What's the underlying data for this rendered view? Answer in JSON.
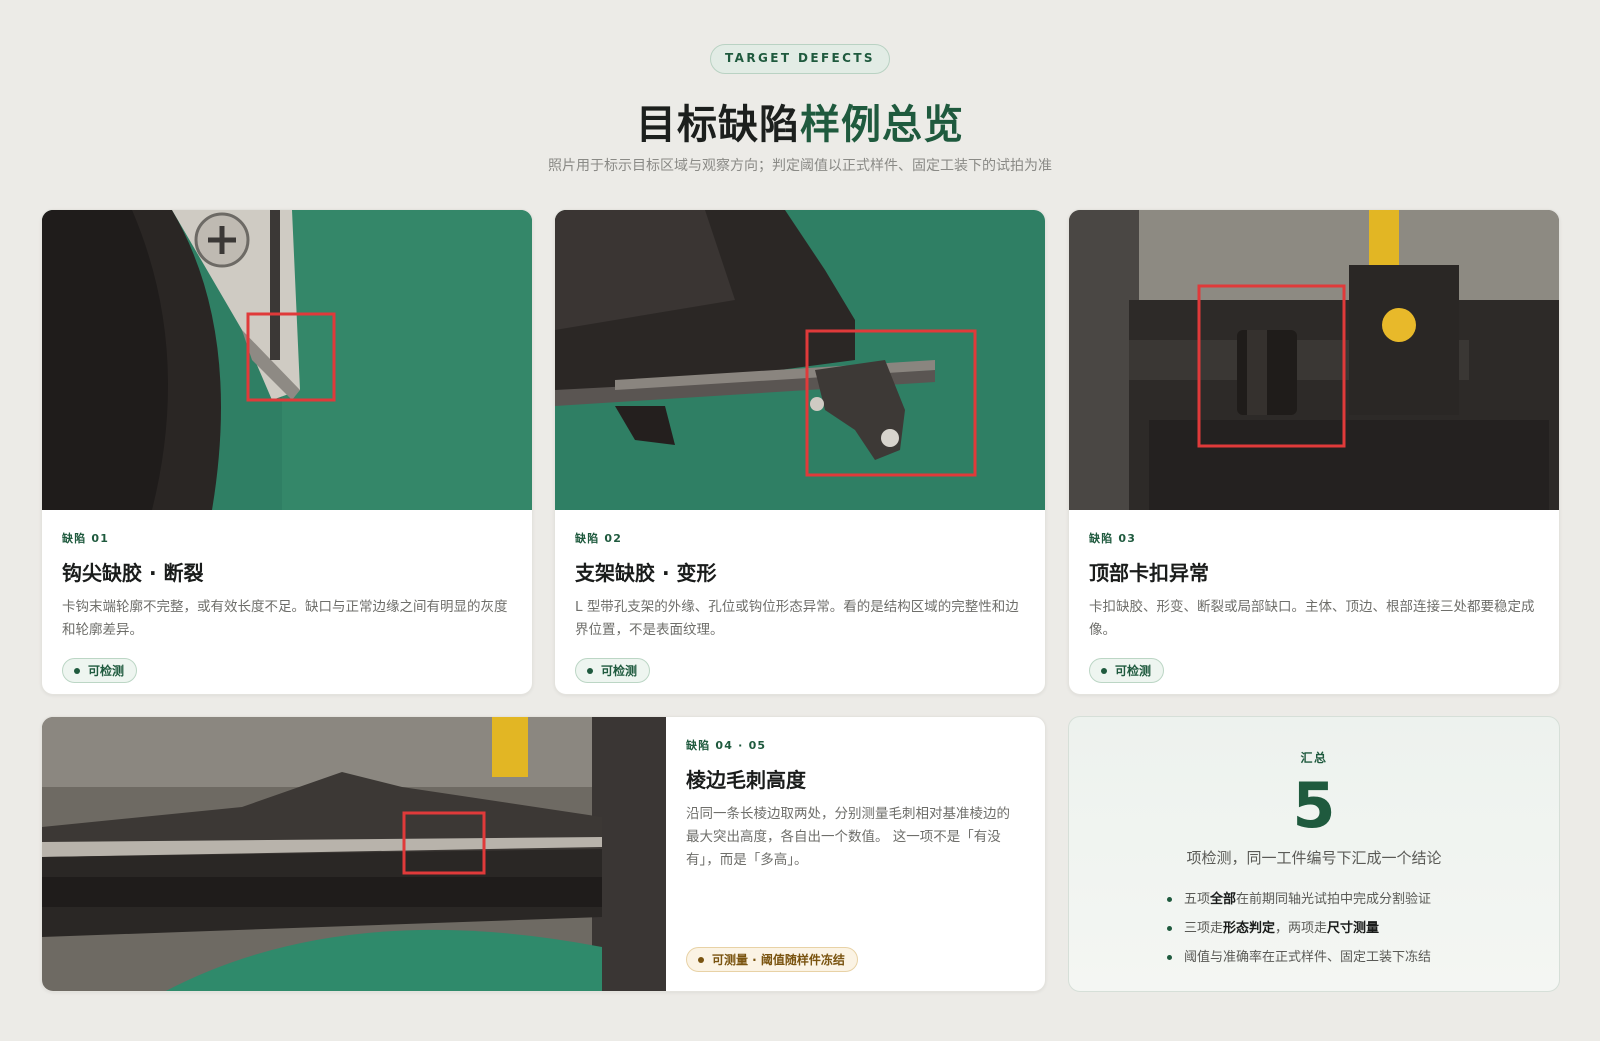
{
  "header": {
    "pill": "TARGET DEFECTS",
    "title_main": "目标缺陷",
    "title_accent": "样例总览",
    "subtitle": "照片用于标示目标区域与观察方向；判定阈值以正式样件、固定工装下的试拍为准"
  },
  "cards": [
    {
      "tag": "缺陷 01",
      "title": "钩尖缺胶 · 断裂",
      "desc": "卡钩末端轮廓不完整，或有效长度不足。缺口与正常边缘之间有明显的灰度和轮廓差异。",
      "badge": "可检测"
    },
    {
      "tag": "缺陷 02",
      "title": "支架缺胶 · 变形",
      "desc": "L 型带孔支架的外缘、孔位或钩位形态异常。看的是结构区域的完整性和边界位置，不是表面纹理。",
      "badge": "可检测"
    },
    {
      "tag": "缺陷 03",
      "title": "顶部卡扣异常",
      "desc": "卡扣缺胶、形变、断裂或局部缺口。主体、顶边、根部连接三处都要稳定成像。",
      "badge": "可检测"
    },
    {
      "tag": "缺陷 04 · 05",
      "title": "棱边毛刺高度",
      "desc": "沿同一条长棱边取两处，分别测量毛刺相对基准棱边的最大突出高度，各自出一个数值。 这一项不是「有没有」，而是「多高」。",
      "badge": "可测量 · 阈值随样件冻结"
    }
  ],
  "summary": {
    "tag": "汇总",
    "count": "5",
    "line": "项检测，同一工件编号下汇成一个结论",
    "items": [
      {
        "pre": "五项",
        "bold": "全部",
        "post": "在前期同轴光试拍中完成分割验证",
        "bold2": "",
        "post2": ""
      },
      {
        "pre": "三项走",
        "bold": "形态判定",
        "post": "，两项走",
        "bold2": "尺寸测量",
        "post2": ""
      },
      {
        "pre": "阈值与准确率在正式样件、固定工装下冻结",
        "bold": "",
        "post": "",
        "bold2": "",
        "post2": ""
      }
    ]
  },
  "colors": {
    "accent": "#1f5a3e",
    "marker": "#e03a3a",
    "background": "#ecebe7"
  }
}
